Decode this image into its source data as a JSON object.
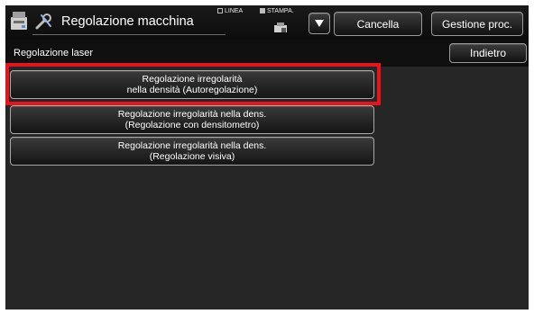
{
  "header": {
    "title": "Regolazione macchina",
    "status_linea": "LINEA",
    "status_stampa": "STAMPA.",
    "cancel_label": "Cancella",
    "manage_label": "Gestione proc."
  },
  "subheader": {
    "title": "Regolazione laser",
    "back_label": "Indietro"
  },
  "options": [
    {
      "line1": "Regolazione irregolarità",
      "line2": "nella densità (Autoregolazione)"
    },
    {
      "line1": "Regolazione irregolarità nella dens.",
      "line2": "(Regolazione con densitometro)"
    },
    {
      "line1": "Regolazione irregolarità nella dens.",
      "line2": "(Regolazione visiva)"
    }
  ],
  "colors": {
    "background": "#262626",
    "header": "#0f0f0f",
    "highlight": "#e8141b",
    "text": "#ffffff"
  }
}
